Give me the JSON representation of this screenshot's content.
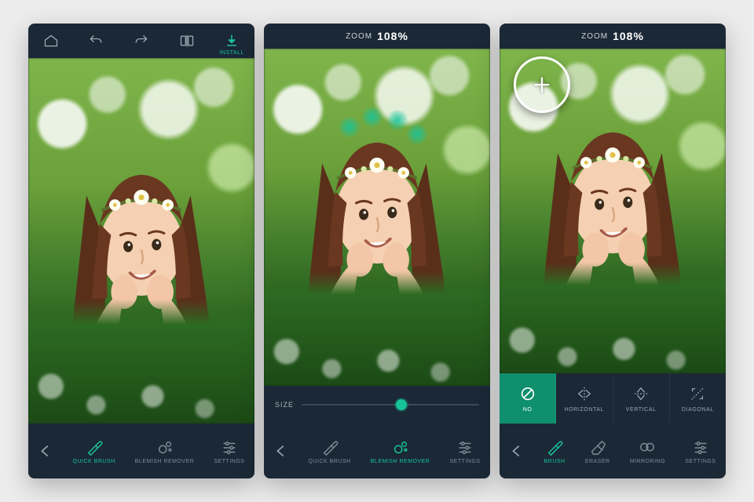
{
  "accent": "#17c49a",
  "screens": [
    {
      "topbar": {
        "install_label": "INSTALL"
      },
      "toolbar": {
        "tools": [
          {
            "label": "QUICK BRUSH",
            "active": true
          },
          {
            "label": "BLEMISH REMOVER",
            "active": false
          },
          {
            "label": "SETTINGS",
            "active": false
          }
        ]
      }
    },
    {
      "zoom": {
        "label": "ZOOM",
        "value": "108%"
      },
      "size": {
        "label": "SIZE",
        "position_pct": 56
      },
      "toolbar": {
        "tools": [
          {
            "label": "QUICK BRUSH",
            "active": false
          },
          {
            "label": "BLEMISH REMOVER",
            "active": true
          },
          {
            "label": "SETTINGS",
            "active": false
          }
        ]
      }
    },
    {
      "zoom": {
        "label": "ZOOM",
        "value": "108%"
      },
      "mirror": {
        "options": [
          {
            "label": "NO",
            "active": true
          },
          {
            "label": "HORIZONTAL",
            "active": false
          },
          {
            "label": "VERTICAL",
            "active": false
          },
          {
            "label": "DIAGONAL",
            "active": false
          }
        ]
      },
      "toolbar": {
        "tools": [
          {
            "label": "BRUSH",
            "active": true
          },
          {
            "label": "ERASER",
            "active": false
          },
          {
            "label": "MIRRORING",
            "active": false
          },
          {
            "label": "SETTINGS",
            "active": false
          }
        ]
      }
    }
  ]
}
